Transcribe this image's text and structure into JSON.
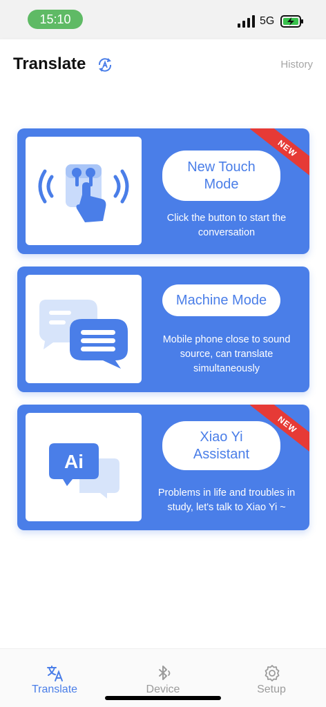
{
  "status_bar": {
    "time": "15:10",
    "network": "5G"
  },
  "header": {
    "title": "Translate",
    "history_label": "History"
  },
  "cards": [
    {
      "button_label": "New Touch Mode",
      "description": "Click the button to start the conversation",
      "badge": "NEW"
    },
    {
      "button_label": "Machine Mode",
      "description": "Mobile phone close to sound source, can translate simultaneously"
    },
    {
      "button_label": "Xiao Yi Assistant",
      "description": "Problems in life and troubles in study, let's talk to Xiao Yi ~",
      "badge": "NEW"
    }
  ],
  "ai_icon_text": "Ai",
  "tabs": [
    {
      "label": "Translate",
      "icon": "translate-icon",
      "active": true
    },
    {
      "label": "Device",
      "icon": "bluetooth-icon",
      "active": false
    },
    {
      "label": "Setup",
      "icon": "gear-icon",
      "active": false
    }
  ],
  "colors": {
    "accent": "#4a7ee8",
    "badge": "#e63a36",
    "inactive": "#9b9b9b",
    "status_pill": "#5fba65"
  }
}
